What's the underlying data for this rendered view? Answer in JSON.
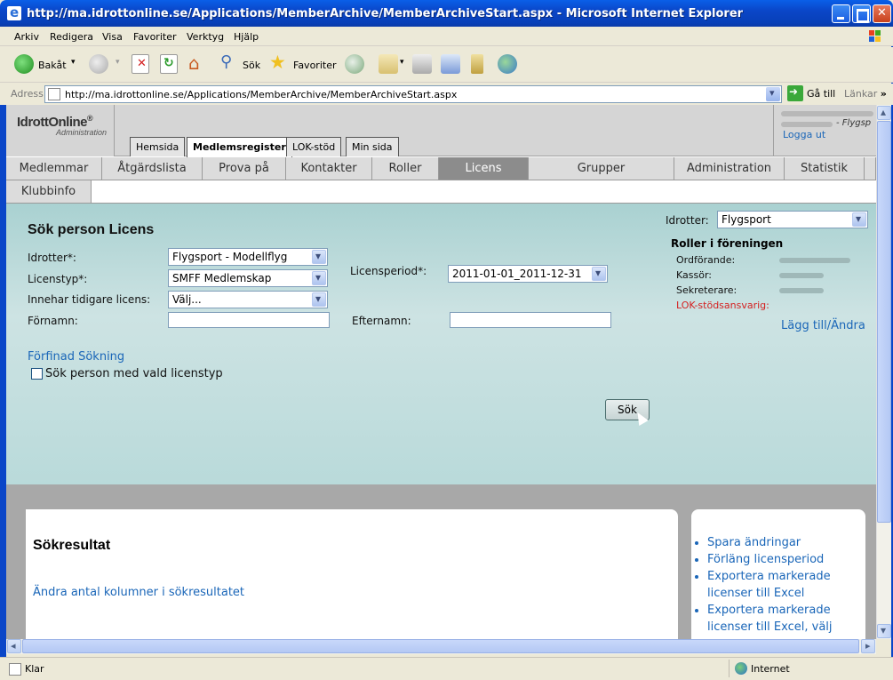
{
  "window": {
    "title": "http://ma.idrottonline.se/Applications/MemberArchive/MemberArchiveStart.aspx - Microsoft Internet Explorer"
  },
  "menu": [
    "Arkiv",
    "Redigera",
    "Visa",
    "Favoriter",
    "Verktyg",
    "Hjälp"
  ],
  "toolbar": {
    "back": "Bakåt",
    "search": "Sök",
    "favorites": "Favoriter"
  },
  "address": {
    "label": "Adress",
    "url": "http://ma.idrottonline.se/Applications/MemberArchive/MemberArchiveStart.aspx",
    "go": "Gå till",
    "links": "Länkar"
  },
  "site": {
    "logo": "IdrottOnline",
    "logo_mark": "®",
    "logo_sub": "Administration",
    "top_tabs": [
      "Hemsida",
      "Medlemsregister",
      "LOK-stöd",
      "Min sida"
    ],
    "user_org": "- Flygsp",
    "logout": "Logga ut"
  },
  "nav": {
    "row1": [
      "Medlemmar",
      "Åtgärdslista",
      "Prova på",
      "Kontakter",
      "Roller",
      "Licens",
      "Grupper",
      "Administration",
      "Statistik"
    ],
    "row2": [
      "Klubbinfo"
    ],
    "active": "Licens"
  },
  "search": {
    "heading": "Sök person Licens",
    "sport_label": "Idrotter*:",
    "sport_value": "Flygsport - Modellflyg",
    "license_type_label": "Licenstyp*:",
    "license_type_value": "SMFF Medlemskap",
    "previous_license_label": "Innehar tidigare licens:",
    "previous_license_value": "Välj...",
    "firstname_label": "Förnamn:",
    "license_period_label": "Licensperiod*:",
    "license_period_value": "2011-01-01_2011-12-31",
    "lastname_label": "Efternamn:",
    "refined_search": "Förfinad Sökning",
    "checkbox_label": "Sök person med vald licenstyp",
    "search_button": "Sök"
  },
  "sidebar_filter": {
    "label": "Idrotter:",
    "value": "Flygsport",
    "roles_title": "Roller i föreningen",
    "roles": [
      "Ordförande:",
      "Kassör:",
      "Sekreterare:",
      "LOK-stödsansvarig:"
    ],
    "edit_link": "Lägg till/Ändra"
  },
  "results": {
    "heading": "Sökresultat",
    "columns_link": "Ändra antal kolumner i sökresultatet"
  },
  "actions": [
    "Spara ändringar",
    "Förläng licensperiod",
    "Exportera markerade licenser till Excel",
    "Exportera markerade licenser till Excel, välj"
  ],
  "status": {
    "left": "Klar",
    "zone": "Internet"
  },
  "colors": {
    "link": "#1a66b8",
    "alert": "#d42020",
    "search_panel": "#bcdcdc",
    "active_nav": "#8c8c8c"
  }
}
